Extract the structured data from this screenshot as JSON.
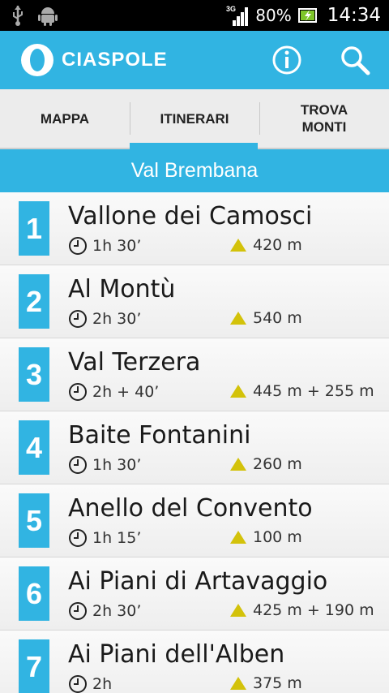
{
  "status_bar": {
    "network": "3G",
    "battery": "80%",
    "time": "14:34",
    "icons": [
      "usb-icon",
      "android-icon",
      "signal-icon",
      "battery-icon"
    ]
  },
  "app": {
    "name": "CIASPOLE",
    "accent_color": "#31b4e2",
    "actions": [
      "info-icon",
      "search-icon"
    ]
  },
  "tabs": [
    {
      "label": "MAPPA",
      "active": false
    },
    {
      "label": "ITINERARI",
      "active": true
    },
    {
      "label_line1": "TROVA",
      "label_line2": "MONTI",
      "active": false
    }
  ],
  "region": "Val Brembana",
  "routes": [
    {
      "num": "1",
      "name": "Vallone dei Camosci",
      "time": "1h 30’",
      "elevation": "420 m"
    },
    {
      "num": "2",
      "name": "Al Montù",
      "time": "2h 30’",
      "elevation": "540 m"
    },
    {
      "num": "3",
      "name": "Val Terzera",
      "time": "2h + 40’",
      "elevation": "445 m + 255 m"
    },
    {
      "num": "4",
      "name": "Baite Fontanini",
      "time": "1h 30’",
      "elevation": "260 m"
    },
    {
      "num": "5",
      "name": "Anello del Convento",
      "time": "1h 15’",
      "elevation": "100 m"
    },
    {
      "num": "6",
      "name": "Ai Piani di Artavaggio",
      "time": "2h 30’",
      "elevation": "425 m + 190 m"
    },
    {
      "num": "7",
      "name": "Ai Piani dell'Alben",
      "time": "2h",
      "elevation": "375 m"
    }
  ]
}
